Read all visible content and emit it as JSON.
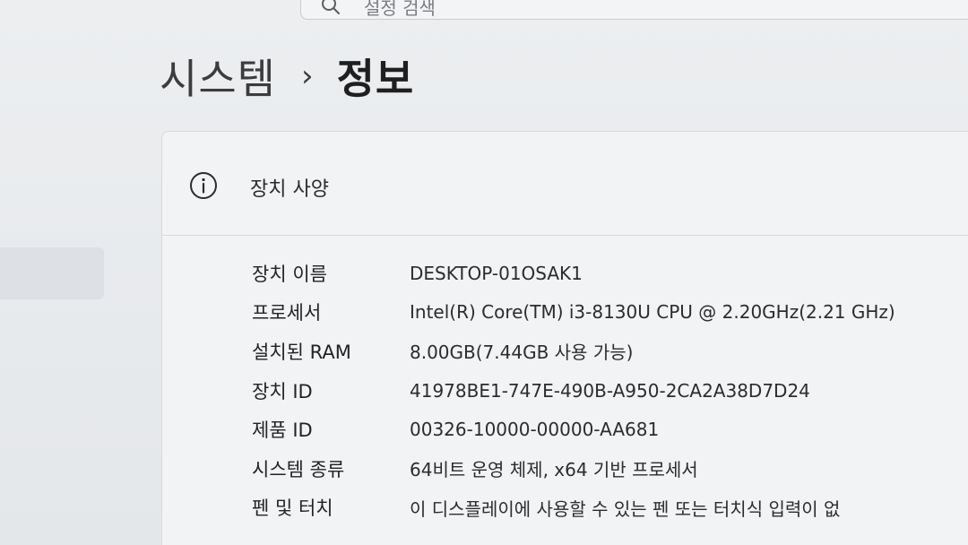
{
  "search": {
    "placeholder": "설정 검색"
  },
  "breadcrumb": {
    "parent": "시스템",
    "separator": "›",
    "current": "정보"
  },
  "device_specs": {
    "icon": "info-icon",
    "title": "장치 사양",
    "rows": [
      {
        "label": "장치 이름",
        "value": "DESKTOP-01OSAK1"
      },
      {
        "label": "프로세서",
        "value": "Intel(R) Core(TM) i3-8130U CPU @ 2.20GHz(2.21 GHz)"
      },
      {
        "label": "설치된 RAM",
        "value": "8.00GB(7.44GB 사용 가능)"
      },
      {
        "label": "장치 ID",
        "value": "41978BE1-747E-490B-A950-2CA2A38D7D24"
      },
      {
        "label": "제품 ID",
        "value": "00326-10000-00000-AA681"
      },
      {
        "label": "시스템 종류",
        "value": "64비트 운영 체제, x64 기반 프로세서"
      },
      {
        "label": "펜 및 터치",
        "value": "이 디스플레이에 사용할 수 있는 펜 또는 터치식 입력이 없"
      }
    ]
  }
}
